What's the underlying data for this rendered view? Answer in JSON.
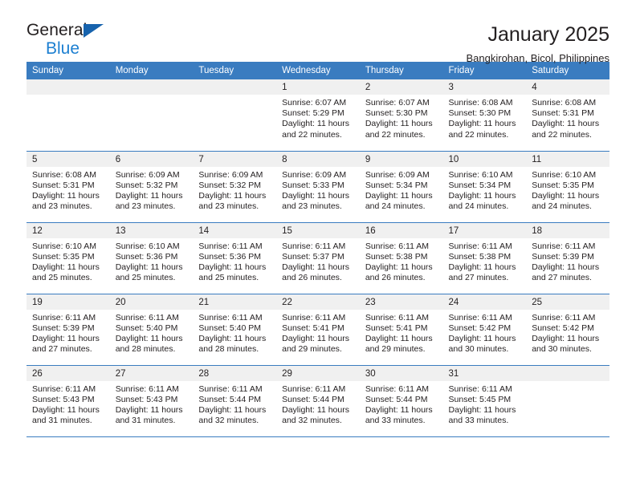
{
  "brand": {
    "name_dark": "General",
    "name_blue": "Blue",
    "triangle_icon": "triangle-icon",
    "accent_color": "#1763ad",
    "blue_text_color": "#1c7fd1"
  },
  "header": {
    "title": "January 2025",
    "subtitle": "Bangkirohan, Bicol, Philippines"
  },
  "theme": {
    "header_band": "#3a7cc0",
    "day_band": "#f0f0f0",
    "text": "#231f20"
  },
  "weekdays": [
    "Sunday",
    "Monday",
    "Tuesday",
    "Wednesday",
    "Thursday",
    "Friday",
    "Saturday"
  ],
  "labels": {
    "sunrise_prefix": "Sunrise: ",
    "sunset_prefix": "Sunset: ",
    "daylight_prefix": "Daylight: "
  },
  "weeks": [
    [
      {
        "day": "",
        "empty": true
      },
      {
        "day": "",
        "empty": true
      },
      {
        "day": "",
        "empty": true
      },
      {
        "day": "1",
        "sunrise": "Sunrise: 6:07 AM",
        "sunset": "Sunset: 5:29 PM",
        "daylight1": "Daylight: 11 hours",
        "daylight2": "and 22 minutes."
      },
      {
        "day": "2",
        "sunrise": "Sunrise: 6:07 AM",
        "sunset": "Sunset: 5:30 PM",
        "daylight1": "Daylight: 11 hours",
        "daylight2": "and 22 minutes."
      },
      {
        "day": "3",
        "sunrise": "Sunrise: 6:08 AM",
        "sunset": "Sunset: 5:30 PM",
        "daylight1": "Daylight: 11 hours",
        "daylight2": "and 22 minutes."
      },
      {
        "day": "4",
        "sunrise": "Sunrise: 6:08 AM",
        "sunset": "Sunset: 5:31 PM",
        "daylight1": "Daylight: 11 hours",
        "daylight2": "and 22 minutes."
      }
    ],
    [
      {
        "day": "5",
        "sunrise": "Sunrise: 6:08 AM",
        "sunset": "Sunset: 5:31 PM",
        "daylight1": "Daylight: 11 hours",
        "daylight2": "and 23 minutes."
      },
      {
        "day": "6",
        "sunrise": "Sunrise: 6:09 AM",
        "sunset": "Sunset: 5:32 PM",
        "daylight1": "Daylight: 11 hours",
        "daylight2": "and 23 minutes."
      },
      {
        "day": "7",
        "sunrise": "Sunrise: 6:09 AM",
        "sunset": "Sunset: 5:32 PM",
        "daylight1": "Daylight: 11 hours",
        "daylight2": "and 23 minutes."
      },
      {
        "day": "8",
        "sunrise": "Sunrise: 6:09 AM",
        "sunset": "Sunset: 5:33 PM",
        "daylight1": "Daylight: 11 hours",
        "daylight2": "and 23 minutes."
      },
      {
        "day": "9",
        "sunrise": "Sunrise: 6:09 AM",
        "sunset": "Sunset: 5:34 PM",
        "daylight1": "Daylight: 11 hours",
        "daylight2": "and 24 minutes."
      },
      {
        "day": "10",
        "sunrise": "Sunrise: 6:10 AM",
        "sunset": "Sunset: 5:34 PM",
        "daylight1": "Daylight: 11 hours",
        "daylight2": "and 24 minutes."
      },
      {
        "day": "11",
        "sunrise": "Sunrise: 6:10 AM",
        "sunset": "Sunset: 5:35 PM",
        "daylight1": "Daylight: 11 hours",
        "daylight2": "and 24 minutes."
      }
    ],
    [
      {
        "day": "12",
        "sunrise": "Sunrise: 6:10 AM",
        "sunset": "Sunset: 5:35 PM",
        "daylight1": "Daylight: 11 hours",
        "daylight2": "and 25 minutes."
      },
      {
        "day": "13",
        "sunrise": "Sunrise: 6:10 AM",
        "sunset": "Sunset: 5:36 PM",
        "daylight1": "Daylight: 11 hours",
        "daylight2": "and 25 minutes."
      },
      {
        "day": "14",
        "sunrise": "Sunrise: 6:11 AM",
        "sunset": "Sunset: 5:36 PM",
        "daylight1": "Daylight: 11 hours",
        "daylight2": "and 25 minutes."
      },
      {
        "day": "15",
        "sunrise": "Sunrise: 6:11 AM",
        "sunset": "Sunset: 5:37 PM",
        "daylight1": "Daylight: 11 hours",
        "daylight2": "and 26 minutes."
      },
      {
        "day": "16",
        "sunrise": "Sunrise: 6:11 AM",
        "sunset": "Sunset: 5:38 PM",
        "daylight1": "Daylight: 11 hours",
        "daylight2": "and 26 minutes."
      },
      {
        "day": "17",
        "sunrise": "Sunrise: 6:11 AM",
        "sunset": "Sunset: 5:38 PM",
        "daylight1": "Daylight: 11 hours",
        "daylight2": "and 27 minutes."
      },
      {
        "day": "18",
        "sunrise": "Sunrise: 6:11 AM",
        "sunset": "Sunset: 5:39 PM",
        "daylight1": "Daylight: 11 hours",
        "daylight2": "and 27 minutes."
      }
    ],
    [
      {
        "day": "19",
        "sunrise": "Sunrise: 6:11 AM",
        "sunset": "Sunset: 5:39 PM",
        "daylight1": "Daylight: 11 hours",
        "daylight2": "and 27 minutes."
      },
      {
        "day": "20",
        "sunrise": "Sunrise: 6:11 AM",
        "sunset": "Sunset: 5:40 PM",
        "daylight1": "Daylight: 11 hours",
        "daylight2": "and 28 minutes."
      },
      {
        "day": "21",
        "sunrise": "Sunrise: 6:11 AM",
        "sunset": "Sunset: 5:40 PM",
        "daylight1": "Daylight: 11 hours",
        "daylight2": "and 28 minutes."
      },
      {
        "day": "22",
        "sunrise": "Sunrise: 6:11 AM",
        "sunset": "Sunset: 5:41 PM",
        "daylight1": "Daylight: 11 hours",
        "daylight2": "and 29 minutes."
      },
      {
        "day": "23",
        "sunrise": "Sunrise: 6:11 AM",
        "sunset": "Sunset: 5:41 PM",
        "daylight1": "Daylight: 11 hours",
        "daylight2": "and 29 minutes."
      },
      {
        "day": "24",
        "sunrise": "Sunrise: 6:11 AM",
        "sunset": "Sunset: 5:42 PM",
        "daylight1": "Daylight: 11 hours",
        "daylight2": "and 30 minutes."
      },
      {
        "day": "25",
        "sunrise": "Sunrise: 6:11 AM",
        "sunset": "Sunset: 5:42 PM",
        "daylight1": "Daylight: 11 hours",
        "daylight2": "and 30 minutes."
      }
    ],
    [
      {
        "day": "26",
        "sunrise": "Sunrise: 6:11 AM",
        "sunset": "Sunset: 5:43 PM",
        "daylight1": "Daylight: 11 hours",
        "daylight2": "and 31 minutes."
      },
      {
        "day": "27",
        "sunrise": "Sunrise: 6:11 AM",
        "sunset": "Sunset: 5:43 PM",
        "daylight1": "Daylight: 11 hours",
        "daylight2": "and 31 minutes."
      },
      {
        "day": "28",
        "sunrise": "Sunrise: 6:11 AM",
        "sunset": "Sunset: 5:44 PM",
        "daylight1": "Daylight: 11 hours",
        "daylight2": "and 32 minutes."
      },
      {
        "day": "29",
        "sunrise": "Sunrise: 6:11 AM",
        "sunset": "Sunset: 5:44 PM",
        "daylight1": "Daylight: 11 hours",
        "daylight2": "and 32 minutes."
      },
      {
        "day": "30",
        "sunrise": "Sunrise: 6:11 AM",
        "sunset": "Sunset: 5:44 PM",
        "daylight1": "Daylight: 11 hours",
        "daylight2": "and 33 minutes."
      },
      {
        "day": "31",
        "sunrise": "Sunrise: 6:11 AM",
        "sunset": "Sunset: 5:45 PM",
        "daylight1": "Daylight: 11 hours",
        "daylight2": "and 33 minutes."
      },
      {
        "day": "",
        "empty": true
      }
    ]
  ]
}
